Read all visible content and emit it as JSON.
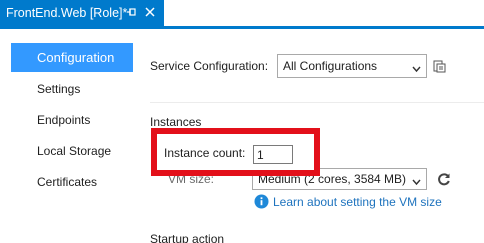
{
  "colors": {
    "accent": "#007acc",
    "selection": "#3399ff",
    "highlight_border": "#e3101a",
    "link": "#1e73be"
  },
  "document_tab": {
    "title": "FrontEnd.Web [Role]*",
    "pin_icon": "pin-icon",
    "close_icon": "close-icon"
  },
  "sidebar": {
    "items": [
      {
        "label": "Configuration",
        "selected": true
      },
      {
        "label": "Settings",
        "selected": false
      },
      {
        "label": "Endpoints",
        "selected": false
      },
      {
        "label": "Local Storage",
        "selected": false
      },
      {
        "label": "Certificates",
        "selected": false
      }
    ]
  },
  "service_configuration": {
    "label": "Service Configuration:",
    "selected": "All Configurations",
    "action_icon": "manage-configurations-icon"
  },
  "instances": {
    "heading": "Instances",
    "count_label": "Instance count:",
    "count_value": "1",
    "vm_size_label": "VM size:",
    "vm_size_selected": "Medium (2 cores, 3584 MB)",
    "refresh_icon": "refresh-icon",
    "info_icon": "info-icon",
    "learn_link": "Learn about setting the VM size"
  },
  "startup": {
    "heading": "Startup action"
  }
}
